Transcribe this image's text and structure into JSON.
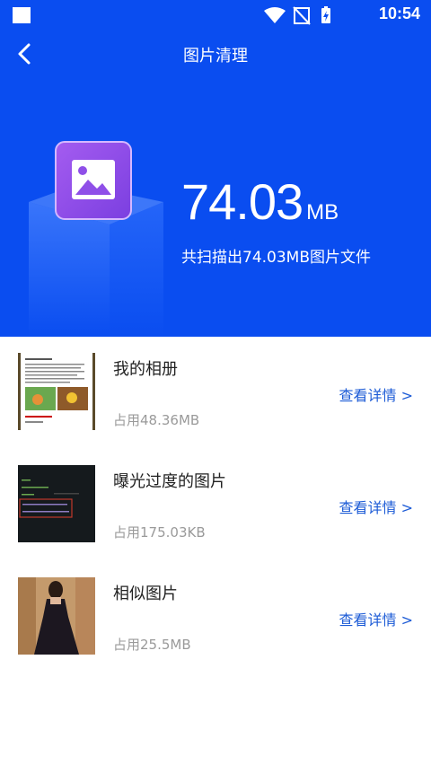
{
  "status": {
    "time": "10:54"
  },
  "topbar": {
    "title": "图片清理"
  },
  "summary": {
    "size_value": "74.03",
    "size_unit": "MB",
    "scan_text": "共扫描出74.03MB图片文件"
  },
  "items": [
    {
      "title": "我的相册",
      "usage": "占用48.36MB",
      "link": "查看详情 >"
    },
    {
      "title": "曝光过度的图片",
      "usage": "占用175.03KB",
      "link": "查看详情 >"
    },
    {
      "title": "相似图片",
      "usage": "占用25.5MB",
      "link": "查看详情 >"
    }
  ],
  "colors": {
    "brand_blue": "#0a4df0",
    "link_blue": "#1c5bd6",
    "purple_icon": "#8f4fe8"
  }
}
